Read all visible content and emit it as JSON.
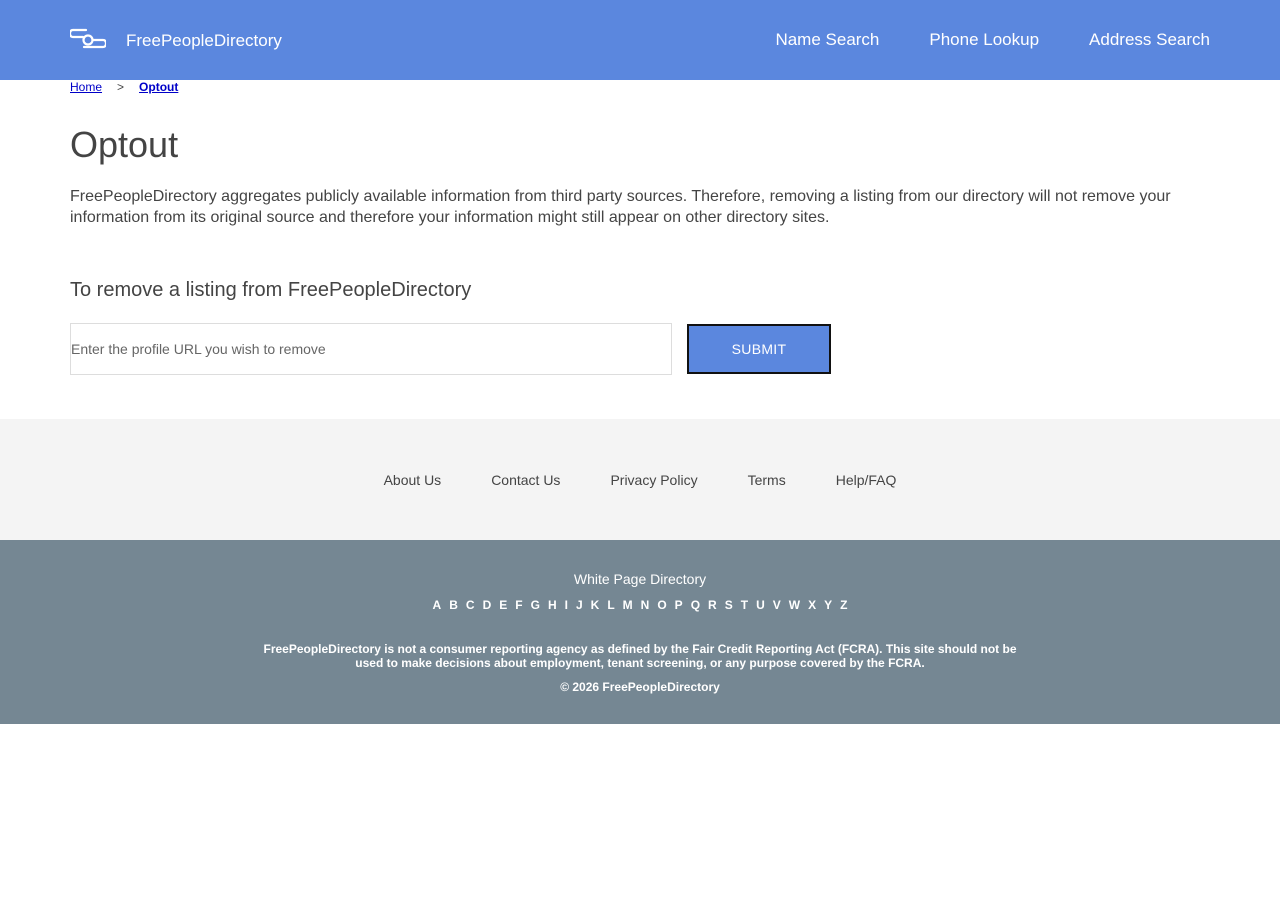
{
  "header": {
    "brand": "FreePeopleDirectory",
    "logo_icon": "link-chain-icon",
    "nav": [
      {
        "label": "Name Search"
      },
      {
        "label": "Phone Lookup"
      },
      {
        "label": "Address Search"
      }
    ],
    "background_color": "#5b87de"
  },
  "breadcrumb": {
    "home": "Home",
    "separator": ">",
    "current": "Optout"
  },
  "main": {
    "title": "Optout",
    "intro": "FreePeopleDirectory aggregates publicly available information from third party sources. Therefore, removing a listing from our directory will not remove your information from its original source and therefore your information might still appear on other directory sites.",
    "section_title": "To remove a listing from FreePeopleDirectory",
    "url_input": {
      "value": "",
      "placeholder": "Enter the profile URL you wish to remove"
    },
    "submit_label": "SUBMIT",
    "accent_color": "#5b87de"
  },
  "footer_links": [
    {
      "label": "About Us"
    },
    {
      "label": "Contact Us"
    },
    {
      "label": "Privacy Policy"
    },
    {
      "label": "Terms"
    },
    {
      "label": "Help/FAQ"
    }
  ],
  "footer": {
    "directory_title": "White Page Directory",
    "letters": [
      "A",
      "B",
      "C",
      "D",
      "E",
      "F",
      "G",
      "H",
      "I",
      "J",
      "K",
      "L",
      "M",
      "N",
      "O",
      "P",
      "Q",
      "R",
      "S",
      "T",
      "U",
      "V",
      "W",
      "X",
      "Y",
      "Z"
    ],
    "disclaimer": "FreePeopleDirectory is not a consumer reporting agency as defined by the Fair Credit Reporting Act (FCRA). This site should not be used to make decisions about employment, tenant screening, or any purpose covered by the FCRA.",
    "copyright": "© 2026 FreePeopleDirectory",
    "background_color": "#758793"
  }
}
